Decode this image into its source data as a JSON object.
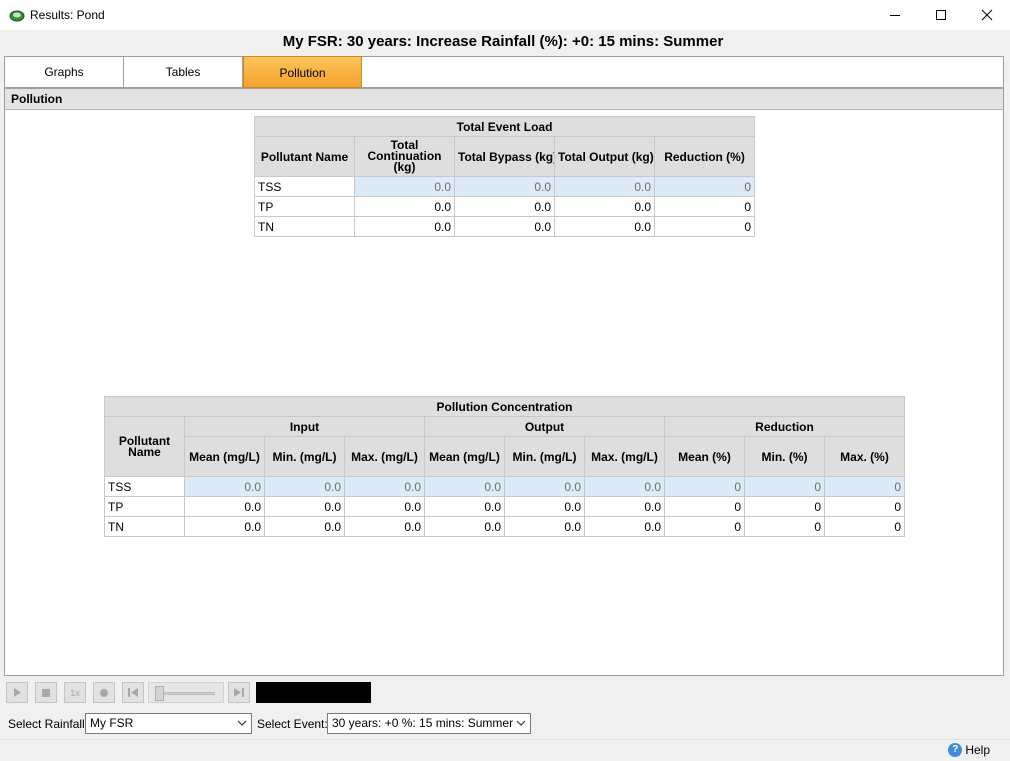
{
  "window": {
    "title": "Results: Pond"
  },
  "heading": "My FSR: 30 years: Increase Rainfall (%): +0: 15 mins: Summer",
  "tabs": [
    {
      "label": "Graphs",
      "active": false
    },
    {
      "label": "Tables",
      "active": false
    },
    {
      "label": "Pollution",
      "active": true
    }
  ],
  "section": {
    "title": "Pollution"
  },
  "event_load": {
    "title": "Total Event Load",
    "headers": [
      "Pollutant Name",
      "Total Continuation (kg)",
      "Total Bypass (kg)",
      "Total Output (kg)",
      "Reduction (%)"
    ],
    "rows": [
      {
        "name": "TSS",
        "values": [
          "0.0",
          "0.0",
          "0.0",
          "0"
        ]
      },
      {
        "name": "TP",
        "values": [
          "0.0",
          "0.0",
          "0.0",
          "0"
        ]
      },
      {
        "name": "TN",
        "values": [
          "0.0",
          "0.0",
          "0.0",
          "0"
        ]
      }
    ]
  },
  "concentration": {
    "title": "Pollution Concentration",
    "name_header": "Pollutant Name",
    "groups": [
      "Input",
      "Output",
      "Reduction"
    ],
    "subheaders": [
      "Mean (mg/L)",
      "Min. (mg/L)",
      "Max. (mg/L)",
      "Mean (mg/L)",
      "Min. (mg/L)",
      "Max. (mg/L)",
      "Mean (%)",
      "Min. (%)",
      "Max. (%)"
    ],
    "rows": [
      {
        "name": "TSS",
        "values": [
          "0.0",
          "0.0",
          "0.0",
          "0.0",
          "0.0",
          "0.0",
          "0",
          "0",
          "0"
        ]
      },
      {
        "name": "TP",
        "values": [
          "0.0",
          "0.0",
          "0.0",
          "0.0",
          "0.0",
          "0.0",
          "0",
          "0",
          "0"
        ]
      },
      {
        "name": "TN",
        "values": [
          "0.0",
          "0.0",
          "0.0",
          "0.0",
          "0.0",
          "0.0",
          "0",
          "0",
          "0"
        ]
      }
    ]
  },
  "playback": {
    "speed_label": "1x"
  },
  "selectors": {
    "rainfall_label": "Select Rainfall:",
    "rainfall_value": "My FSR",
    "event_label": "Select Event:",
    "event_value": "30 years: +0 %: 15 mins: Summer"
  },
  "help": {
    "label": "Help",
    "icon_glyph": "?"
  },
  "colors": {
    "active_tab": "#f6a935",
    "selected_row": "#ddeaf8",
    "header_bg": "#dedede"
  }
}
